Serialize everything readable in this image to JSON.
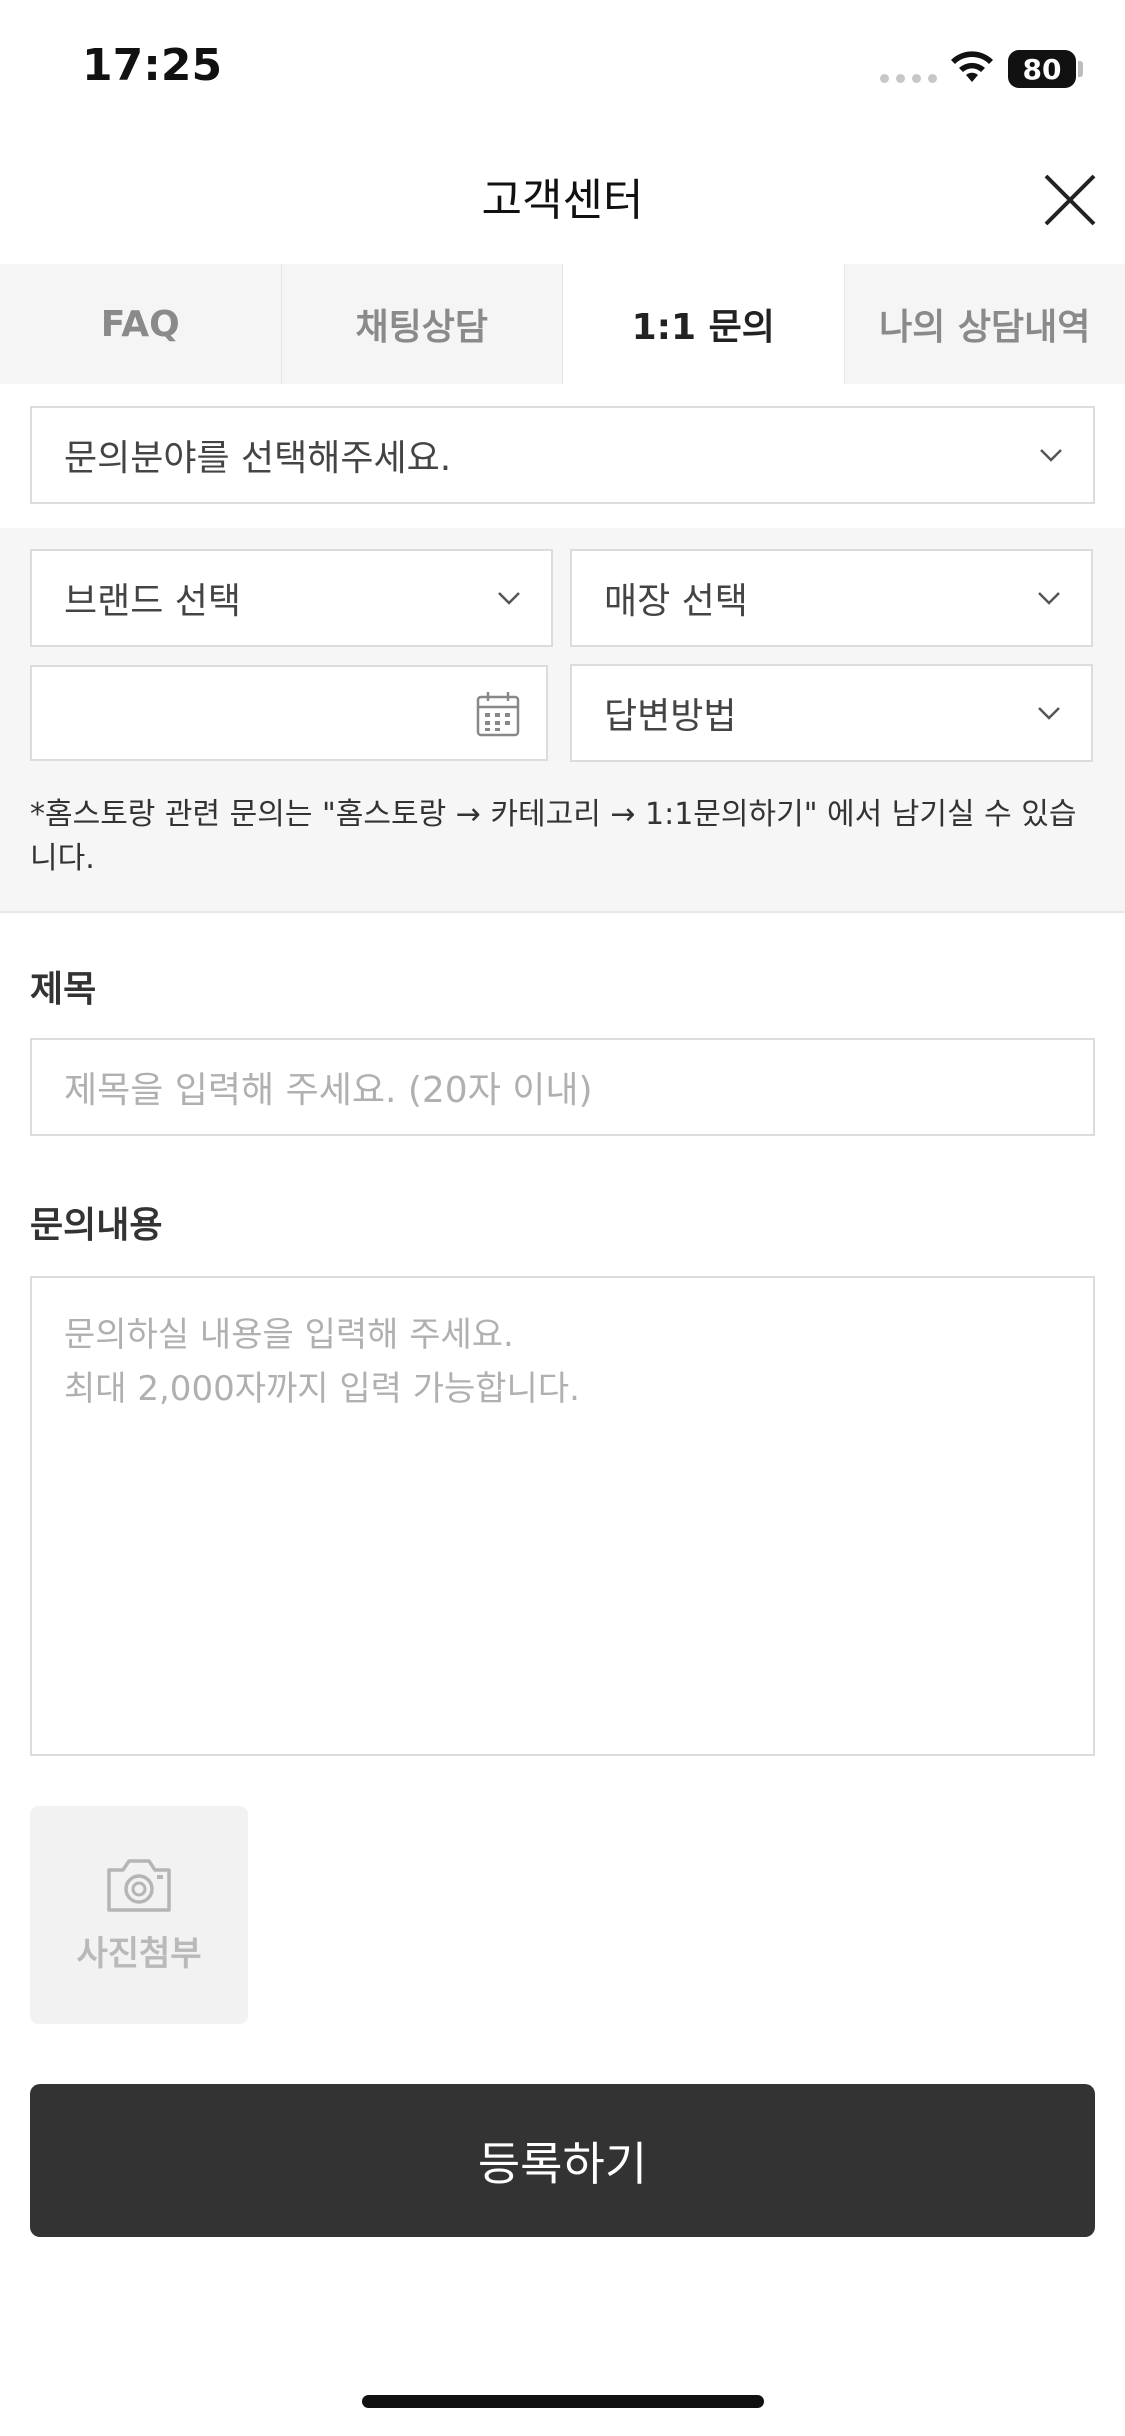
{
  "status_bar": {
    "time": "17:25",
    "battery": "80"
  },
  "header": {
    "title": "고객센터"
  },
  "tabs": [
    {
      "label": "FAQ",
      "active": false
    },
    {
      "label": "채팅상담",
      "active": false
    },
    {
      "label": "1:1 문의",
      "active": true
    },
    {
      "label": "나의 상담내역",
      "active": false
    }
  ],
  "form": {
    "category_select": "문의분야를 선택해주세요.",
    "brand_select": "브랜드 선택",
    "store_select": "매장 선택",
    "date_value": "",
    "answer_method_select": "답변방법",
    "notice": "*홈스토랑 관련 문의는 \"홈스토랑 → 카테고리 → 1:1문의하기\" 에서 남기실 수 있습니다.",
    "title_label": "제목",
    "title_placeholder": "제목을 입력해 주세요. (20자 이내)",
    "content_label": "문의내용",
    "content_placeholder_line1": "문의하실 내용을 입력해 주세요.",
    "content_placeholder_line2": "최대 2,000자까지 입력 가능합니다.",
    "photo_label": "사진첨부",
    "submit_label": "등록하기"
  },
  "icons": [
    "wifi-icon",
    "battery-icon",
    "close-icon",
    "chevron-down-icon",
    "calendar-icon",
    "camera-icon"
  ]
}
